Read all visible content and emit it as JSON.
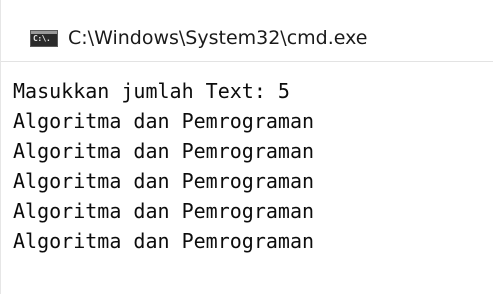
{
  "window": {
    "title": "C:\\Windows\\System32\\cmd.exe",
    "icon": "cmd-console-icon",
    "icon_glyph": "C:\\."
  },
  "console": {
    "lines": [
      "Masukkan jumlah Text: 5",
      "Algoritma dan Pemrograman",
      "Algoritma dan Pemrograman",
      "Algoritma dan Pemrograman",
      "Algoritma dan Pemrograman",
      "Algoritma dan Pemrograman"
    ]
  },
  "colors": {
    "background": "#ffffff",
    "text": "#0c0c0c",
    "icon_background": "#2b2b2b"
  }
}
